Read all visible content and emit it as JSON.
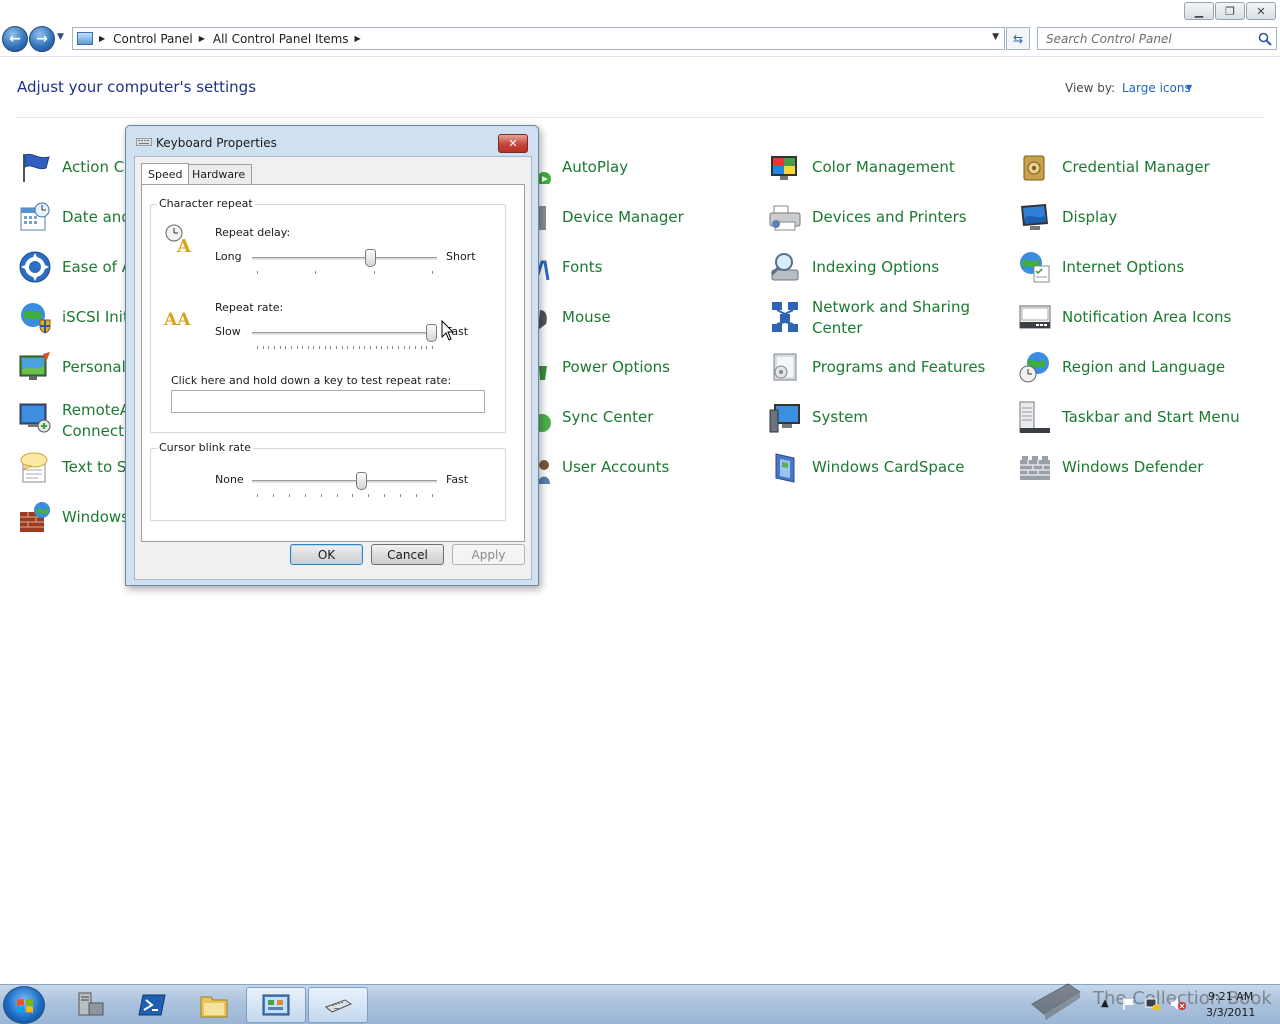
{
  "window": {
    "controls": [
      "minimize-icon",
      "restore-icon",
      "close-icon"
    ]
  },
  "nav": {
    "breadcrumb": [
      "Control Panel",
      "All Control Panel Items"
    ],
    "search_placeholder": "Search Control Panel"
  },
  "header": {
    "title": "Adjust your computer's settings",
    "view_by_label": "View by:",
    "view_by_value": "Large icons"
  },
  "items": [
    {
      "label": "Action Center",
      "icon": "flag-icon"
    },
    {
      "label": "Date and Time",
      "icon": "calendar-clock-icon"
    },
    {
      "label": "Ease of Access Center",
      "icon": "ease-of-access-icon"
    },
    {
      "label": "iSCSI Initiator",
      "icon": "globe-shield-icon"
    },
    {
      "label": "Personalization",
      "icon": "monitor-paint-icon"
    },
    {
      "label": "RemoteApp and Desktop Connections",
      "icon": "remote-desktop-icon"
    },
    {
      "label": "Text to Speech",
      "icon": "speech-bubble-icon"
    },
    {
      "label": "Windows Firewall",
      "icon": "brick-wall-icon"
    },
    {
      "label": "AutoPlay",
      "icon": "autoplay-icon"
    },
    {
      "label": "Device Manager",
      "icon": "device-manager-icon"
    },
    {
      "label": "Fonts",
      "icon": "fonts-icon"
    },
    {
      "label": "Mouse",
      "icon": "mouse-icon"
    },
    {
      "label": "Power Options",
      "icon": "power-icon"
    },
    {
      "label": "Sync Center",
      "icon": "sync-icon"
    },
    {
      "label": "User Accounts",
      "icon": "user-icon"
    },
    {
      "label": "Color Management",
      "icon": "color-management-icon"
    },
    {
      "label": "Devices and Printers",
      "icon": "printer-icon"
    },
    {
      "label": "Indexing Options",
      "icon": "magnifier-icon"
    },
    {
      "label": "Network and Sharing Center",
      "icon": "network-icon"
    },
    {
      "label": "Programs and Features",
      "icon": "programs-icon"
    },
    {
      "label": "System",
      "icon": "system-icon"
    },
    {
      "label": "Windows CardSpace",
      "icon": "cardspace-icon"
    },
    {
      "label": "Credential Manager",
      "icon": "vault-icon"
    },
    {
      "label": "Display",
      "icon": "display-icon"
    },
    {
      "label": "Internet Options",
      "icon": "internet-options-icon"
    },
    {
      "label": "Notification Area Icons",
      "icon": "notification-icon"
    },
    {
      "label": "Region and Language",
      "icon": "region-globe-icon"
    },
    {
      "label": "Taskbar and Start Menu",
      "icon": "taskbar-icon"
    },
    {
      "label": "Windows Defender",
      "icon": "defender-wall-icon"
    }
  ],
  "visible_labels": {
    "action": "Action Ce",
    "date": "Date and",
    "ease": "Ease of A",
    "iscsi": "iSCSI Init",
    "personal": "Personali",
    "remote1": "RemoteA",
    "remote2": "Connectio",
    "text": "Text to Sp",
    "windows": "Windows"
  },
  "dialog": {
    "title": "Keyboard Properties",
    "tabs": [
      "Speed",
      "Hardware"
    ],
    "character_repeat": {
      "group_label": "Character repeat",
      "repeat_delay_label": "Repeat delay:",
      "repeat_delay_min": "Long",
      "repeat_delay_max": "Short",
      "repeat_delay_value": 0.65,
      "repeat_rate_label": "Repeat rate:",
      "repeat_rate_min": "Slow",
      "repeat_rate_max": "Fast",
      "repeat_rate_value": 1.0,
      "test_label": "Click here and hold down a key to test repeat rate:"
    },
    "cursor_blink": {
      "group_label": "Cursor blink rate",
      "min": "None",
      "max": "Fast",
      "value": 0.6
    },
    "buttons": {
      "ok": "OK",
      "cancel": "Cancel",
      "apply": "Apply"
    }
  },
  "taskbar": {
    "items": [
      "server-manager-icon",
      "powershell-icon",
      "explorer-folder-icon",
      "control-panel-icon",
      "keyboard-icon"
    ],
    "clock_time": "9:21 AM",
    "clock_date": "3/3/2011",
    "watermark": "The Collection Book"
  }
}
